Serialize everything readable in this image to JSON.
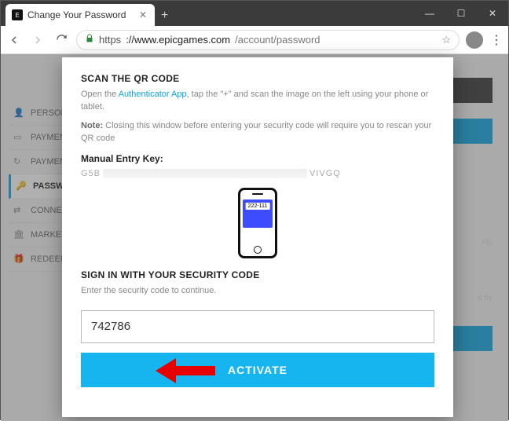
{
  "window": {
    "tab_title": "Change Your Password",
    "url_scheme": "https",
    "url_host": "://www.epicgames.com",
    "url_path": "/account/password"
  },
  "sidebar": {
    "items": [
      {
        "label": "PERSON"
      },
      {
        "label": "PAYMEN"
      },
      {
        "label": "PAYMEN"
      },
      {
        "label": "PASSW"
      },
      {
        "label": "CONNE"
      },
      {
        "label": "MARKET"
      },
      {
        "label": "REDEEM"
      }
    ]
  },
  "bg_text": {
    "t1": "rity",
    "t2": "d by"
  },
  "modal": {
    "h1": "SCAN THE QR CODE",
    "p1_pre": "Open the ",
    "p1_link": "Authenticator App",
    "p1_post": ", tap the \"+\" and scan the image on the left using your phone or tablet.",
    "note_label": "Note:",
    "note_text": " Closing this window before entering your security code will require you to rescan your QR code",
    "manual_label": "Manual Entry Key:",
    "key_prefix": "G5B",
    "key_suffix": "VIVGQ",
    "phone_code": "222-111",
    "h2": "SIGN IN WITH YOUR SECURITY CODE",
    "p2": "Enter the security code to continue.",
    "code_value": "742786",
    "activate": "ACTIVATE"
  }
}
